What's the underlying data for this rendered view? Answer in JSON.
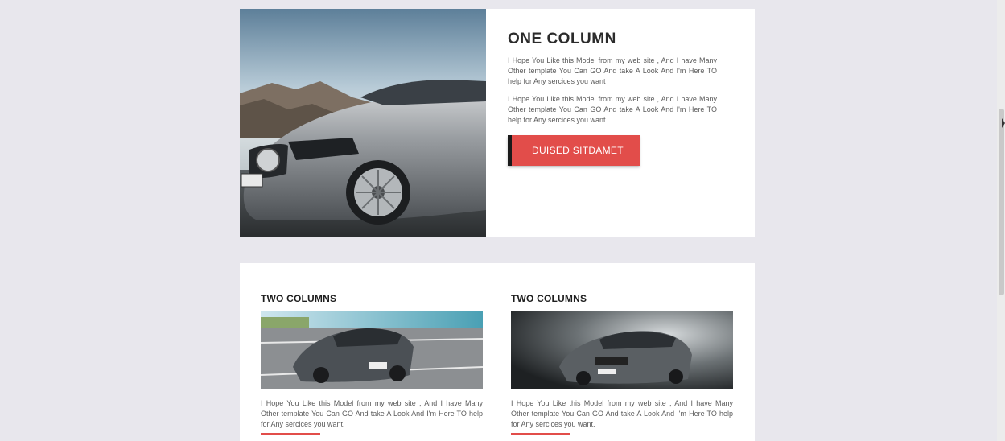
{
  "one_column": {
    "title": "ONE COLUMN",
    "paragraphs": [
      "I Hope You Like this Model from my web site , And I have Many Other template You Can GO And take A Look And I'm Here TO help for Any sercices you want",
      "I Hope You Like this Model from my web site , And I have Many Other template You Can GO And take A Look And I'm Here TO help for Any sercices you want"
    ],
    "button_label": "DUISED SITDAMET"
  },
  "two_columns": [
    {
      "title": "TWO COLUMNS",
      "text": "I Hope You Like this Model from my web site , And I have Many Other template You Can GO And take A Look And I'm Here TO help for Any sercices you want."
    },
    {
      "title": "TWO COLUMNS",
      "text": "I Hope You Like this Model from my web site , And I have Many Other template You Can GO And take A Look And I'm Here TO help for Any sercices you want."
    }
  ],
  "colors": {
    "background": "#e8e7ed",
    "card": "#ffffff",
    "accent_red": "#e24d4a",
    "button_edge": "#1a1a1a",
    "heading": "#2b2b2b",
    "body_text": "#5b5b5b"
  }
}
